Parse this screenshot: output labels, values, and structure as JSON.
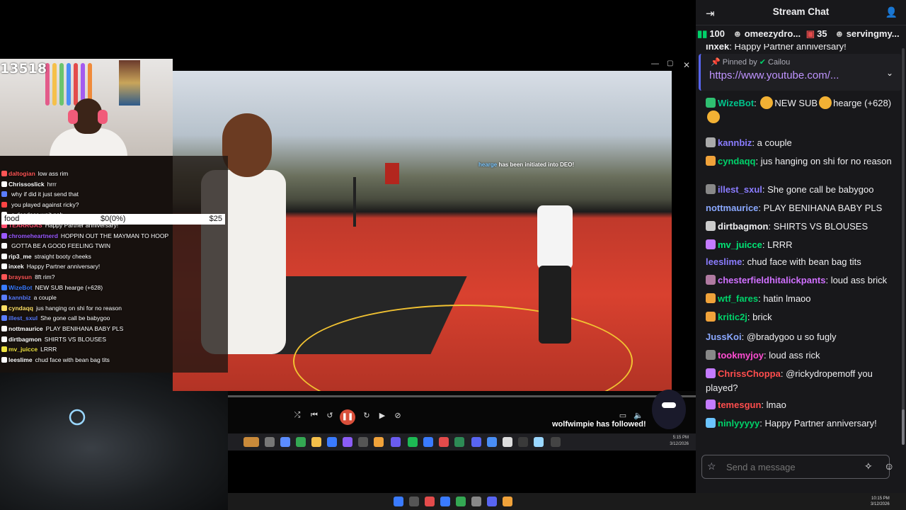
{
  "stream": {
    "viewer_count": "13518",
    "goal": {
      "label": "food",
      "progress": "$0(0%)",
      "target": "$25"
    },
    "overlay_chat": [
      {
        "user": "daltogian",
        "text": "low ass rim",
        "color": "#ff5555"
      },
      {
        "user": "Chrissoslick",
        "text": "hrrr",
        "color": "#ffffff"
      },
      {
        "user": "",
        "text": "why if did it just send that",
        "color": "#5a7dff"
      },
      {
        "user": "",
        "text": "you played against ricky?",
        "color": "#ff4444"
      },
      {
        "user": "",
        "text": "o deadass wait nah",
        "color": "#ffffff"
      },
      {
        "user": "TEARRGAS",
        "text": "Happy Partner anniversary!",
        "color": "#ff4d6d"
      },
      {
        "user": "chromeheartnerd",
        "text": "HOPPIN OUT THE MAYMAN TO HOOP",
        "color": "#9b59ff"
      },
      {
        "user": "",
        "text": "GOTTA BE A GOOD FEELING TWIN",
        "color": "#ffffff"
      },
      {
        "user": "rip3_me",
        "text": "straight booty cheeks",
        "color": "#ffffff"
      },
      {
        "user": "inxek",
        "text": "Happy Partner anniversary!",
        "color": "#ffffff"
      },
      {
        "user": "braysun",
        "text": "8ft rim?",
        "color": "#ff5555"
      },
      {
        "user": "WizeBot",
        "text": "NEW SUB hearge (+628)",
        "color": "#3a7bff"
      },
      {
        "user": "kannbiz",
        "text": "a couple",
        "color": "#5a7dff"
      },
      {
        "user": "cyndaqq",
        "text": "jus hanging on shi for no reason",
        "color": "#ffe066"
      },
      {
        "user": "illest_sxul",
        "text": "She gone call be babygoo",
        "color": "#5a7dff"
      },
      {
        "user": "nottmaurice",
        "text": "PLAY BENIHANA BABY PLS",
        "color": "#ffffff"
      },
      {
        "user": "dirtbagmon",
        "text": "SHIRTS VS BLOUSES",
        "color": "#ffffff"
      },
      {
        "user": "mv_juicce",
        "text": "LRRR",
        "color": "#f0e442"
      },
      {
        "user": "leeslime",
        "text": "chud face with bean bag tits",
        "color": "#ffffff"
      }
    ],
    "notifications": {
      "initiated_user": "hearge",
      "initiated_text": "has been initiated into DEO!",
      "followed": "wolfwimpie has followed!"
    },
    "inner_clock": {
      "time": "5:15 PM",
      "date": "3/12/2026"
    },
    "os_clock": {
      "time": "10:15 PM",
      "date": "3/12/2026"
    }
  },
  "chat": {
    "title": "Stream Chat",
    "leaderboard": [
      {
        "label": "100"
      },
      {
        "label": "omeezydro...",
        "extra": "35"
      },
      {
        "label": "servingmy..."
      }
    ],
    "top_partial": {
      "user": "inxek",
      "text": "Happy Partner anniversary!"
    },
    "pinned": {
      "by_prefix": "Pinned by",
      "by_user": "Cailou",
      "link": "https://www.youtube.com/..."
    },
    "messages": [
      {
        "user": "WizeBot",
        "color": "#00c48c",
        "text": "NEW SUB",
        "text2": "hearge (+628)",
        "badge": "#2fbf71"
      },
      {
        "user": "kannbiz",
        "color": "#8a7cff",
        "text": "a couple",
        "badge": "#aaaaaa"
      },
      {
        "user": "cyndaqq",
        "color": "#00d26a",
        "text": "jus hanging on shi for no reason",
        "badge": "#f0a23a"
      },
      {
        "user": "illest_sxul",
        "color": "#8a7cff",
        "text": "She gone call be babygoo",
        "badge": "#888888"
      },
      {
        "user": "nottmaurice",
        "color": "#8aa8ff",
        "text": "PLAY BENIHANA BABY PLS",
        "badge": ""
      },
      {
        "user": "dirtbagmon",
        "color": "#efeff1",
        "text": "SHIRTS VS BLOUSES",
        "badge": "#cccccc"
      },
      {
        "user": "mv_juicce",
        "color": "#00e676",
        "text": "LRRR",
        "badge": "#c47bff"
      },
      {
        "user": "leeslime",
        "color": "#8a7cff",
        "text": "chud face with bean bag tits",
        "badge": ""
      },
      {
        "user": "chesterfieldhitalickpants",
        "color": "#d070ff",
        "text": "loud ass brick",
        "badge": "#b07aa1"
      },
      {
        "user": "wtf_fares",
        "color": "#00d26a",
        "text": "hatin lmaoo",
        "badge": "#f0a23a"
      },
      {
        "user": "kritic2j",
        "color": "#00d26a",
        "text": "brick",
        "badge": "#f0a23a"
      },
      {
        "user": "JussKoi",
        "color": "#8aa8ff",
        "text": "@bradygoo u so fugly",
        "badge": ""
      },
      {
        "user": "tookmyjoy",
        "color": "#ff4dd2",
        "text": "loud ass rick",
        "badge": "#888888"
      },
      {
        "user": "ChrissChoppa",
        "color": "#ff4d4d",
        "text": "@rickydropemoff you played?",
        "badge": "#c47bff"
      },
      {
        "user": "temesgun",
        "color": "#ff4d4d",
        "text": "lmao",
        "badge": "#c47bff"
      },
      {
        "user": "ninlyyyyy",
        "color": "#00d26a",
        "text": "Happy Partner anniversary!",
        "badge": "#6bc4ff"
      }
    ],
    "input_placeholder": "Send a message"
  }
}
